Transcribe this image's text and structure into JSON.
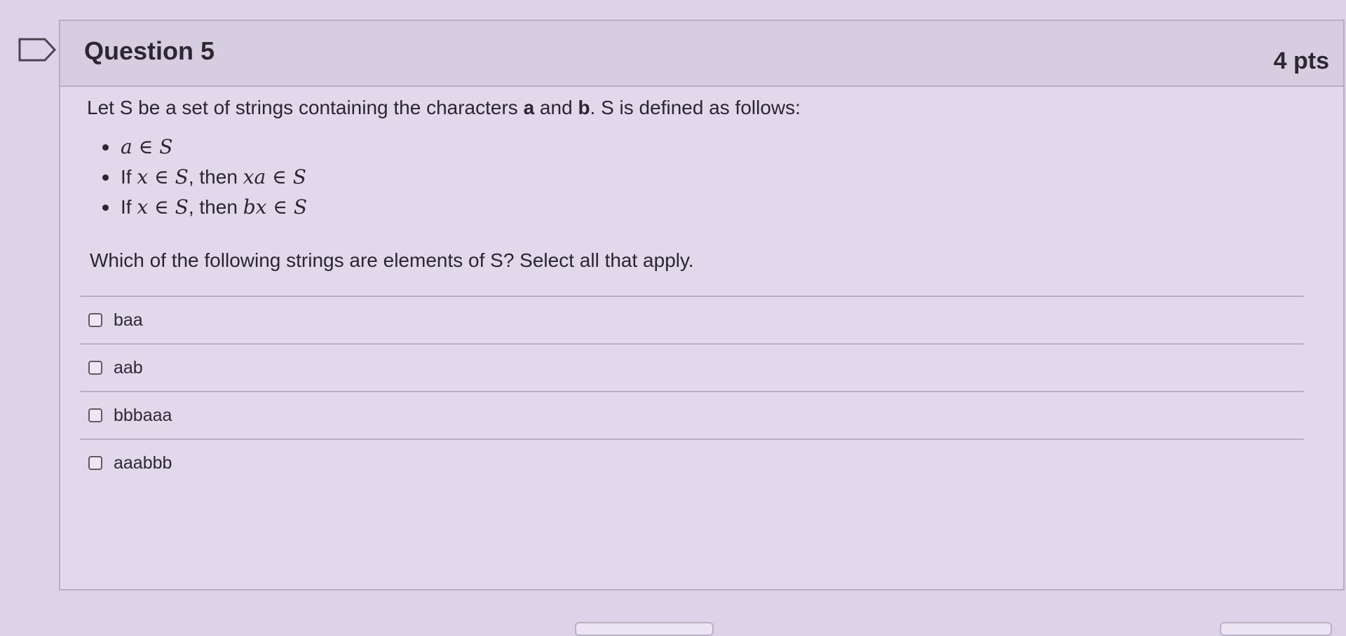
{
  "question": {
    "title": "Question 5",
    "points": "4 pts",
    "intro_prefix": "Let S be a set of strings containing the characters ",
    "char_a": "a",
    "intro_and": " and ",
    "char_b": "b",
    "intro_suffix": ". S is defined as follows:",
    "rules": [
      {
        "prefix": "",
        "math1": "a ∈ S",
        "middle": "",
        "math2": ""
      },
      {
        "prefix": "If ",
        "math1": "x ∈ S",
        "middle": ", then ",
        "math2": "xa ∈ S"
      },
      {
        "prefix": "If ",
        "math1": "x ∈ S",
        "middle": ", then ",
        "math2": "bx ∈ S"
      }
    ],
    "prompt": "Which of the following strings are elements of S?  Select all that apply.",
    "answers": [
      {
        "label": "baa",
        "checked": false
      },
      {
        "label": "aab",
        "checked": false
      },
      {
        "label": "bbbaaa",
        "checked": false
      },
      {
        "label": "aaabbb",
        "checked": false
      }
    ]
  },
  "icons": {
    "flag": "bookmark-flag-icon"
  },
  "colors": {
    "background": "#ddd3e8",
    "card": "#e2d8ec",
    "header": "#d7cde0",
    "border": "#b7aec2",
    "text": "#2a2630"
  }
}
